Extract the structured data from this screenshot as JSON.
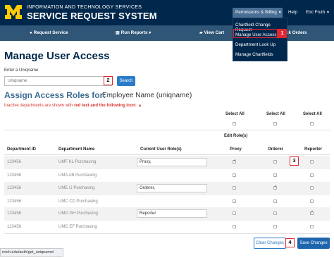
{
  "header": {
    "brand_line1": "INFORMATION AND TECHNOLOGY SERVICES",
    "brand_line2": "SERVICE REQUEST SYSTEM",
    "permissions_menu": "Permissions & Billing",
    "help": "Help",
    "user": "Eric Fruth"
  },
  "nav": {
    "request_service": "Request Service",
    "run_reports": "Run Reports",
    "view_cart": "View Cart",
    "track_orders": "ck Orders"
  },
  "dropdown": {
    "items": [
      "Chartfield Change Request",
      "Manage User Access",
      "Department Look Up",
      "Manage Chartfields"
    ]
  },
  "page": {
    "title": "Manage User Access",
    "enter_label": "Enter a Uniqname",
    "search_placeholder": "Uniqname",
    "search_button": "Search",
    "assign_title": "Assign Access Roles for:",
    "assign_subject": "Employee Name (uniqname)",
    "inactive_note_prefix": "Inactive departments are shown with ",
    "inactive_note_bold": "red text and the following icon:"
  },
  "table": {
    "select_all": "Select All",
    "edit_roles": "Edit Role(s)",
    "columns": [
      "Department ID",
      "Department Name",
      "Current User Role(s)",
      "Proxy",
      "Orderer",
      "Reporter"
    ],
    "rows": [
      {
        "id": "123456",
        "name": "UMF KL Purchasing",
        "role": "Proxy,",
        "proxy": true,
        "orderer": false,
        "reporter": false
      },
      {
        "id": "123456",
        "name": "UMA AB Purchasing",
        "role": "",
        "proxy": false,
        "orderer": false,
        "reporter": false
      },
      {
        "id": "123456",
        "name": "UME IJ Purchasing",
        "role": "Orderer,",
        "proxy": false,
        "orderer": true,
        "reporter": false
      },
      {
        "id": "123456",
        "name": "UMC CD Purchasing",
        "role": "",
        "proxy": false,
        "orderer": false,
        "reporter": false
      },
      {
        "id": "123456",
        "name": "UMD GH Purchasing",
        "role": "Reporter",
        "proxy": false,
        "orderer": false,
        "reporter": true
      },
      {
        "id": "123456",
        "name": "UMC EF Purchasing",
        "role": "",
        "proxy": false,
        "orderer": false,
        "reporter": false
      }
    ]
  },
  "actions": {
    "clear": "Clear Changes",
    "save": "Save Changes"
  },
  "status_url": "mich.edu/auth/get_uniqname/",
  "callouts": [
    "1",
    "2",
    "3",
    "4"
  ],
  "colors": {
    "brand_navy": "#00274c",
    "nav_blue": "#2f5577",
    "maize": "#ffcb05",
    "link_blue": "#2b7bc9",
    "alert_red": "#d9322c",
    "callout_red": "#e0262f"
  }
}
